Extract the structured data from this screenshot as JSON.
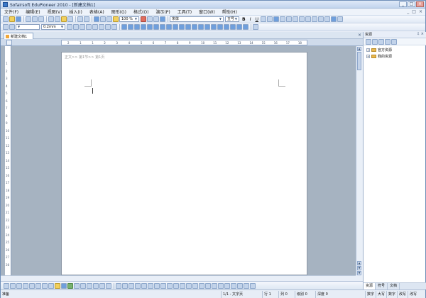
{
  "title": "Sofairsoft EduPioneer 2010 - [新建文档1]",
  "window_buttons": [
    "_",
    "□",
    "×"
  ],
  "menu": [
    "文件(F)",
    "编辑(E)",
    "视图(V)",
    "插入(I)",
    "表格(A)",
    "图形(G)",
    "格式(O)",
    "演示(P)",
    "工具(T)",
    "窗口(W)",
    "帮助(H)"
  ],
  "mdi_buttons": [
    "_",
    "□",
    "×"
  ],
  "toolbar": {
    "zoom": "100 %",
    "font": "宋体",
    "font_size": "五号",
    "line_width": "0.2mm",
    "bold": "B",
    "italic": "I",
    "underline": "U"
  },
  "document_tab": "新建文档1",
  "ruler_marks": [
    "2",
    "1",
    "1",
    "2",
    "3",
    "4",
    "5",
    "6",
    "7",
    "8",
    "9",
    "10",
    "11",
    "12",
    "13",
    "14",
    "15",
    "16",
    "17",
    "18"
  ],
  "vertical_ruler_marks": [
    "1",
    "2",
    "3",
    "4",
    "5",
    "6",
    "7",
    "8",
    "9",
    "10",
    "11",
    "12",
    "13",
    "14",
    "15",
    "16",
    "17",
    "18",
    "19",
    "20",
    "21",
    "22",
    "23",
    "24",
    "25",
    "26",
    "27",
    "28"
  ],
  "page_indicator": "正文>> 第1节>> 第1页",
  "status": {
    "mode": "准备",
    "pages": "1/1 - 文字页",
    "row": "行 1",
    "col": "列 0",
    "level": "级别 0",
    "depth": "深度 0",
    "extra": [
      "数字",
      "大写",
      "数字",
      "改写",
      "改写"
    ]
  },
  "panel": {
    "title": "资源",
    "items": [
      "官方资源",
      "我的资源"
    ],
    "tabs": [
      "资源",
      "符号",
      "文档"
    ]
  }
}
